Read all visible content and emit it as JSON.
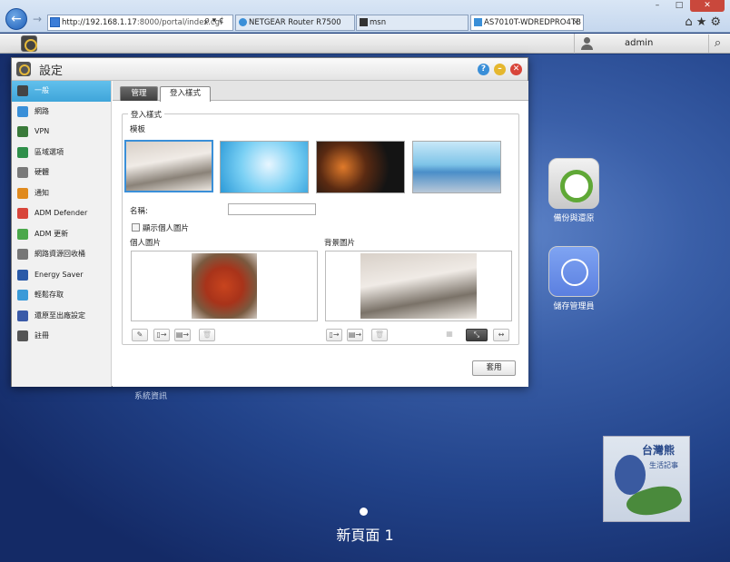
{
  "browser": {
    "address_url_host": "http://192.168.1.17",
    "address_url_rest": ":8000/portal/index.cgi",
    "address_tools": "ρ ▾ ¢",
    "tabs": [
      {
        "label": "NETGEAR Router R7500"
      },
      {
        "label": "msn"
      },
      {
        "label": "AS7010T-WDREDPRO4TB"
      }
    ],
    "window_buttons": [
      "–",
      "□",
      "✕"
    ]
  },
  "adm": {
    "user": "admin"
  },
  "desktop": {
    "icons": [
      {
        "label": "備份與還原"
      },
      {
        "label": "儲存管理員"
      }
    ],
    "system_info_label": "系統資訊",
    "page_label": "新頁面 1",
    "watermark_title": "台灣熊",
    "watermark_sub": "生活記事"
  },
  "window": {
    "title": "設定",
    "help": "?",
    "minimize": "–",
    "close": "✕"
  },
  "sidebar": {
    "items": [
      {
        "label": "一般",
        "color": "#444444"
      },
      {
        "label": "網路",
        "color": "#3a8fd8"
      },
      {
        "label": "VPN",
        "color": "#3a7a3a"
      },
      {
        "label": "區域選項",
        "color": "#2f8f4a"
      },
      {
        "label": "硬體",
        "color": "#7a7a7a"
      },
      {
        "label": "通知",
        "color": "#e08a1e"
      },
      {
        "label": "ADM Defender",
        "color": "#d8453a"
      },
      {
        "label": "ADM 更新",
        "color": "#4aa84a"
      },
      {
        "label": "網路資源回收桶",
        "color": "#777777"
      },
      {
        "label": "Energy Saver",
        "color": "#2a5aa8"
      },
      {
        "label": "輕鬆存取",
        "color": "#3a9ad8"
      },
      {
        "label": "還原至出廠設定",
        "color": "#3a5aa8"
      },
      {
        "label": "註冊",
        "color": "#555555"
      }
    ]
  },
  "content": {
    "tabs": [
      {
        "label": "管理"
      },
      {
        "label": "登入樣式"
      }
    ],
    "section_legend": "登入樣式",
    "template_label": "模板",
    "name_label": "名稱:",
    "name_value": "",
    "show_personal_label": "顯示個人圖片",
    "personal_image_label": "個人圖片",
    "background_image_label": "背景圖片",
    "apply_label": "套用"
  },
  "accent_color": "#3fa5da"
}
